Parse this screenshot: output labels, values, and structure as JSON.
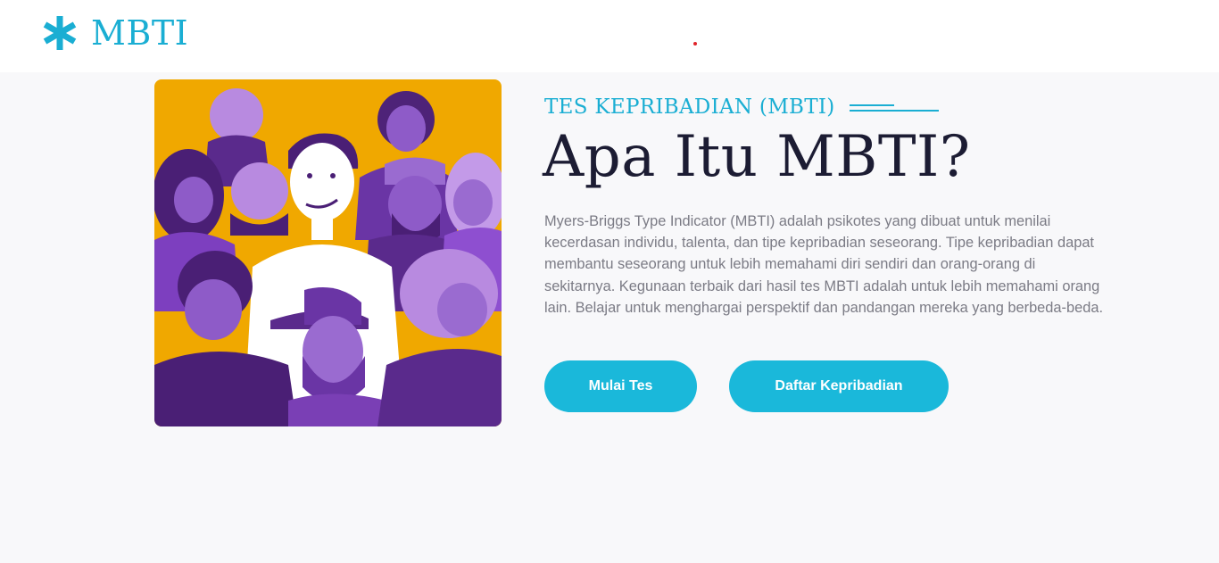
{
  "header": {
    "logo_text": "MBTI",
    "logo_icon": "asterisk-icon"
  },
  "hero": {
    "image": "crowd-illustration",
    "eyebrow": "TES KEPRIBADIAN (MBTI)",
    "title": "Apa Itu MBTI?",
    "description": "Myers-Briggs Type Indicator (MBTI) adalah psikotes yang dibuat untuk menilai kecerdasan individu, talenta, dan tipe kepribadian seseorang. Tipe kepribadian dapat membantu seseorang untuk lebih memahami diri sendiri dan orang-orang di sekitarnya. Kegunaan terbaik dari hasil tes MBTI adalah untuk lebih memahami orang lain. Belajar untuk menghargai perspektif dan pandangan mereka yang berbeda-beda.",
    "buttons": {
      "start_label": "Mulai Tes",
      "list_label": "Daftar Kepribadian"
    }
  },
  "colors": {
    "accent": "#1aaed3",
    "button": "#1ab8da",
    "title": "#1c1c33",
    "body_text": "#7b7b85",
    "illustration_bg": "#f0a800",
    "illustration_purple": "#7a3fb5"
  }
}
